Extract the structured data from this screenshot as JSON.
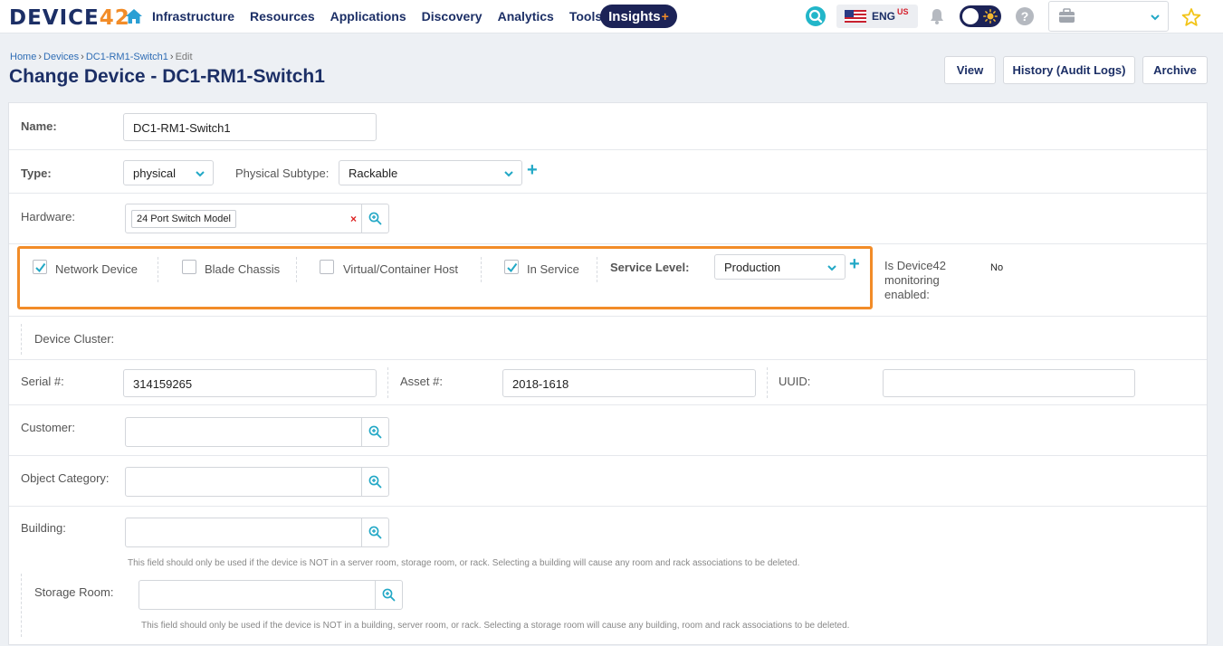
{
  "brand": {
    "logo_main": "DEVICE",
    "logo_num": "42"
  },
  "nav": {
    "items": [
      "Infrastructure",
      "Resources",
      "Applications",
      "Discovery",
      "Analytics",
      "Tools"
    ],
    "insights_label": "Insights",
    "insights_plus": "+",
    "lang_label": "ENG",
    "lang_region": "US",
    "help_label": "?"
  },
  "breadcrumb": {
    "home": "Home",
    "devices": "Devices",
    "device": "DC1-RM1-Switch1",
    "current": "Edit"
  },
  "header": {
    "title": "Change Device - DC1-RM1-Switch1",
    "view_label": "View",
    "history_label": "History (Audit Logs)",
    "archive_label": "Archive"
  },
  "form": {
    "name_label": "Name:",
    "name_value": "DC1-RM1-Switch1",
    "type_label": "Type:",
    "type_value": "physical",
    "subtype_label": "Physical Subtype:",
    "subtype_value": "Rackable",
    "hardware_label": "Hardware:",
    "hardware_value": "24 Port Switch Model",
    "hardware_clear": "×",
    "network_device_label": "Network Device",
    "network_device_checked": true,
    "blade_chassis_label": "Blade Chassis",
    "blade_chassis_checked": false,
    "virtual_host_label": "Virtual/Container Host",
    "virtual_host_checked": false,
    "in_service_label": "In Service",
    "in_service_checked": true,
    "service_level_label": "Service Level:",
    "service_level_value": "Production",
    "monitoring_label_1": "Is Device42",
    "monitoring_label_2": "monitoring",
    "monitoring_label_3": "enabled:",
    "monitoring_value": "No",
    "cluster_label": "Device Cluster:",
    "serial_label": "Serial #:",
    "serial_value": "314159265",
    "asset_label": "Asset #:",
    "asset_value": "2018-1618",
    "uuid_label": "UUID:",
    "uuid_value": "",
    "customer_label": "Customer:",
    "object_category_label": "Object Category:",
    "building_label": "Building:",
    "building_help": "This field should only be used if the device is NOT in a server room, storage room, or rack. Selecting a building will cause any room and rack associations to be deleted.",
    "storage_room_label": "Storage Room:",
    "storage_room_help": "This field should only be used if the device is NOT in a building, server room, or rack. Selecting a storage room will cause any building, room and rack associations to be deleted."
  },
  "colors": {
    "brand_navy": "#1c2f66",
    "accent_orange": "#f28c28",
    "teal": "#22a8c6",
    "link_blue": "#2f6db5"
  },
  "icons": [
    "home-icon",
    "search-icon",
    "us-flag-icon",
    "bell-icon",
    "sun-icon",
    "help-icon",
    "briefcase-icon",
    "chevron-down-icon",
    "star-icon",
    "magnifier-plus-icon",
    "check-icon",
    "plus-icon",
    "clear-x-icon"
  ]
}
